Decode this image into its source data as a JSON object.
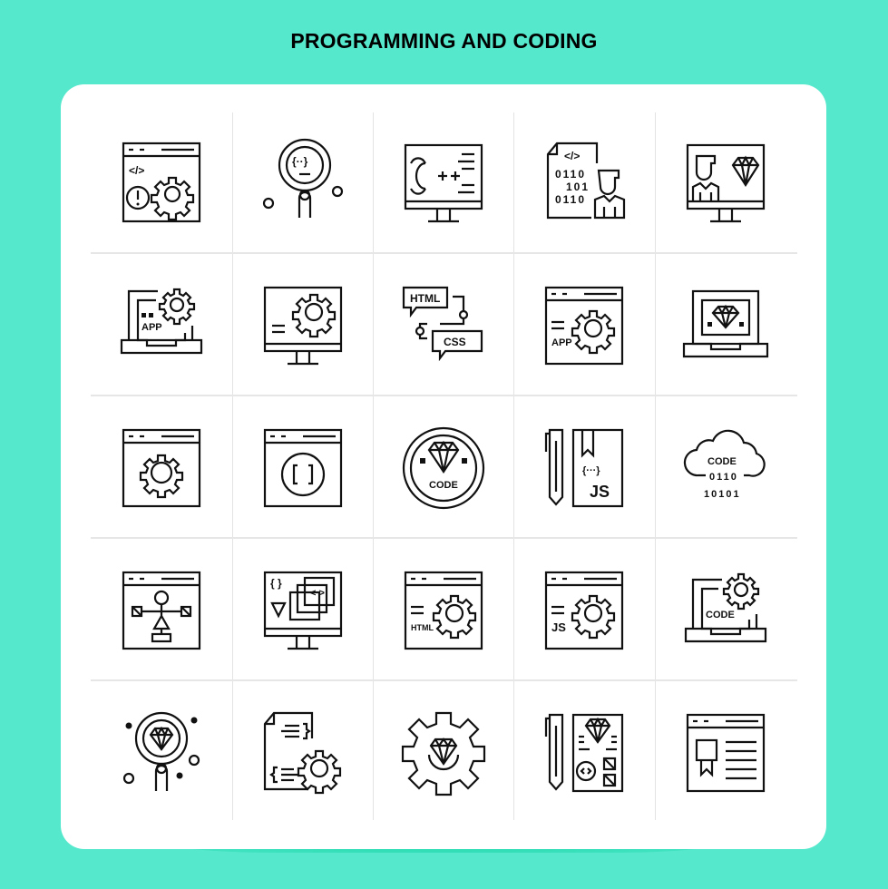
{
  "page": {
    "title": "PROGRAMMING AND CODING",
    "colors": {
      "background": "#56e8cc",
      "card": "#ffffff",
      "icon_stroke": "#111111",
      "grid_line": "#e3e3e3"
    }
  },
  "icons": [
    {
      "name": "web-code-settings-alert",
      "row": 1,
      "col": 1,
      "labels": {
        "tag": "</>"
      }
    },
    {
      "name": "magnifier-code",
      "row": 1,
      "col": 2,
      "labels": {
        "code": "{··}"
      }
    },
    {
      "name": "monitor-cpp",
      "row": 1,
      "col": 3,
      "labels": {
        "lang": "C++"
      }
    },
    {
      "name": "binary-document-developer",
      "row": 1,
      "col": 4,
      "labels": {
        "tag": "</>",
        "bin1": "0110",
        "bin2": "101",
        "bin3": "0110"
      }
    },
    {
      "name": "monitor-developer-diamond",
      "row": 1,
      "col": 5,
      "labels": {}
    },
    {
      "name": "laptop-app-settings",
      "row": 2,
      "col": 1,
      "labels": {
        "text": "APP"
      }
    },
    {
      "name": "monitor-settings",
      "row": 2,
      "col": 2,
      "labels": {}
    },
    {
      "name": "html-css-chat",
      "row": 2,
      "col": 3,
      "labels": {
        "html": "HTML",
        "css": "CSS"
      }
    },
    {
      "name": "web-app-settings",
      "row": 2,
      "col": 4,
      "labels": {
        "text": "APP"
      }
    },
    {
      "name": "laptop-diamond",
      "row": 2,
      "col": 5,
      "labels": {}
    },
    {
      "name": "web-settings",
      "row": 3,
      "col": 1,
      "labels": {}
    },
    {
      "name": "web-brackets",
      "row": 3,
      "col": 2,
      "labels": {
        "code": "[ ]"
      }
    },
    {
      "name": "code-diamond-badge",
      "row": 3,
      "col": 3,
      "labels": {
        "text": "CODE"
      }
    },
    {
      "name": "pencil-js-book",
      "row": 3,
      "col": 4,
      "labels": {
        "code": "{···}",
        "lang": "JS"
      }
    },
    {
      "name": "cloud-code-binary",
      "row": 3,
      "col": 5,
      "labels": {
        "text": "CODE",
        "bin1": "0110",
        "bin2": "10101"
      }
    },
    {
      "name": "web-flowchart",
      "row": 4,
      "col": 1,
      "labels": {}
    },
    {
      "name": "monitor-code-layers",
      "row": 4,
      "col": 2,
      "labels": {
        "braces": "{ }",
        "tag": "< >"
      }
    },
    {
      "name": "web-html-settings",
      "row": 4,
      "col": 3,
      "labels": {
        "text": "HTML"
      }
    },
    {
      "name": "web-js-settings",
      "row": 4,
      "col": 4,
      "labels": {
        "text": "JS"
      }
    },
    {
      "name": "laptop-code-settings",
      "row": 4,
      "col": 5,
      "labels": {
        "text": "CODE"
      }
    },
    {
      "name": "magnifier-diamond",
      "row": 5,
      "col": 1,
      "labels": {}
    },
    {
      "name": "document-code-settings",
      "row": 5,
      "col": 2,
      "labels": {}
    },
    {
      "name": "gear-diamond",
      "row": 5,
      "col": 3,
      "labels": {}
    },
    {
      "name": "pencil-design-sheet",
      "row": 5,
      "col": 4,
      "labels": {}
    },
    {
      "name": "web-award-article",
      "row": 5,
      "col": 5,
      "labels": {}
    }
  ]
}
